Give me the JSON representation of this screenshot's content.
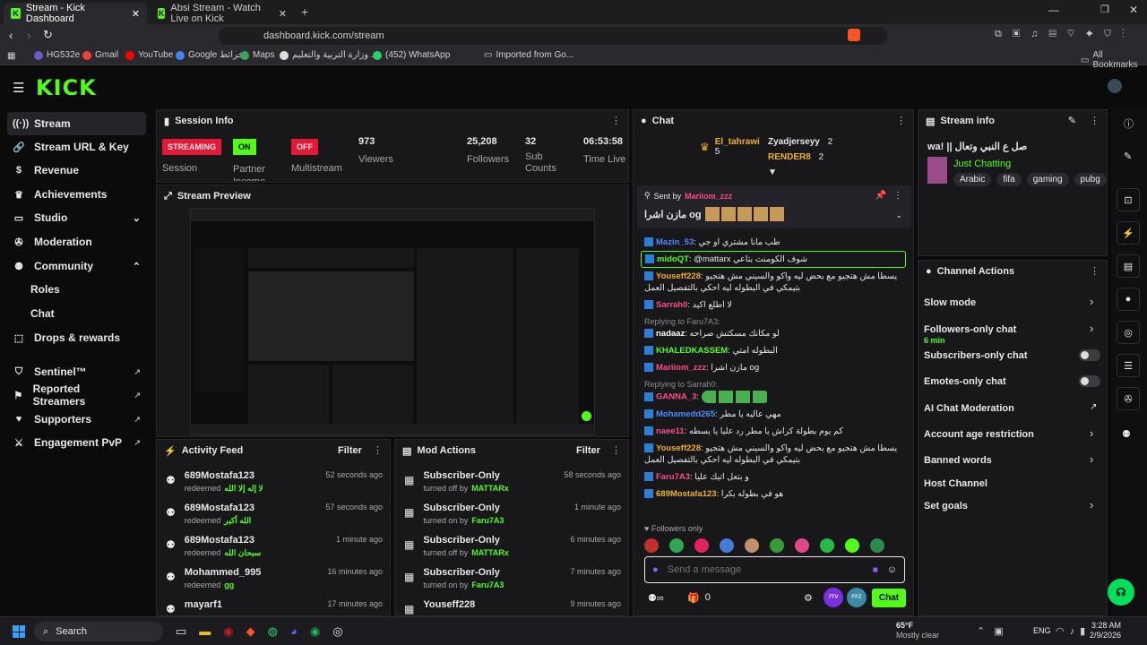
{
  "browser": {
    "tabs": [
      {
        "title": "Stream - Kick Dashboard"
      },
      {
        "title": "Absi Stream - Watch Live on Kick"
      }
    ],
    "url": "dashboard.kick.com/stream",
    "bookmarks": [
      "HG532e",
      "Gmail",
      "YouTube",
      "Google خرائط",
      "Maps",
      "وزارة التربية والتعليم ...",
      "(452) WhatsApp",
      "Imported from Go..."
    ],
    "all_bookmarks": "All Bookmarks"
  },
  "app": {
    "logo": "KICK"
  },
  "sidebar": {
    "items": [
      {
        "label": "Stream",
        "icon": "broadcast-icon"
      },
      {
        "label": "Stream URL & Key",
        "icon": "link-icon"
      },
      {
        "label": "Revenue",
        "icon": "dollar-icon"
      },
      {
        "label": "Achievements",
        "icon": "trophy-icon"
      },
      {
        "label": "Studio",
        "icon": "monitor-icon"
      },
      {
        "label": "Moderation",
        "icon": "wrench-icon"
      },
      {
        "label": "Community",
        "icon": "people-icon"
      },
      {
        "label": "Roles",
        "icon": ""
      },
      {
        "label": "Chat",
        "icon": ""
      },
      {
        "label": "Drops & rewards",
        "icon": "gift-icon"
      },
      {
        "label": "Sentinel™",
        "icon": "shield-icon"
      },
      {
        "label": "Reported Streamers",
        "icon": "flag-icon"
      },
      {
        "label": "Supporters",
        "icon": "heart-icon"
      },
      {
        "label": "Engagement PvP",
        "icon": "swords-icon"
      }
    ]
  },
  "session": {
    "title": "Session Info",
    "streaming_badge": "STREAMING",
    "partner_badge": "ON",
    "multistream_badge": "OFF",
    "session_label": "Session",
    "partner_label": "Partner Income",
    "multistream_label": "Multistream",
    "viewers_value": "973",
    "viewers_label": "Viewers",
    "followers_value": "25,208",
    "followers_label": "Followers",
    "subs_value": "32",
    "subs_label": "Sub Counts",
    "time_value": "06:53:58",
    "time_label": "Time Live"
  },
  "preview": {
    "title": "Stream Preview"
  },
  "activity": {
    "title": "Activity Feed",
    "filter": "Filter",
    "rows": [
      {
        "name": "689Mostafa123",
        "sub": "redeemed",
        "reward": "لا إله إلا الله",
        "time": "52 seconds ago"
      },
      {
        "name": "689Mostafa123",
        "sub": "redeemed",
        "reward": "الله أكبر",
        "time": "57 seconds ago"
      },
      {
        "name": "689Mostafa123",
        "sub": "redeemed",
        "reward": "سبحان الله",
        "time": "1 minute ago"
      },
      {
        "name": "Mohammed_995",
        "sub": "redeemed",
        "reward": "gg",
        "time": "16 minutes ago"
      },
      {
        "name": "mayarf1",
        "sub": "",
        "reward": "",
        "time": "17 minutes ago"
      }
    ]
  },
  "mod": {
    "title": "Mod Actions",
    "filter": "Filter",
    "rows": [
      {
        "name": "Subscriber-Only",
        "sub": "turned off by",
        "by": "MATTARx",
        "time": "58 seconds ago"
      },
      {
        "name": "Subscriber-Only",
        "sub": "turned on by",
        "by": "Faru7A3",
        "time": "1 minute ago"
      },
      {
        "name": "Subscriber-Only",
        "sub": "turned off by",
        "by": "MATTARx",
        "time": "6 minutes ago"
      },
      {
        "name": "Subscriber-Only",
        "sub": "turned on by",
        "by": "Faru7A3",
        "time": "7 minutes ago"
      },
      {
        "name": "Youseff228",
        "sub": "",
        "by": "",
        "time": "9 minutes ago"
      }
    ]
  },
  "chat": {
    "title": "Chat",
    "top_users": [
      {
        "name": "El_tahrawi",
        "count": "5"
      },
      {
        "name": "Zyadjerseyy",
        "count": "2"
      },
      {
        "name": "RENDER8",
        "count": "2"
      }
    ],
    "pinned": {
      "sent_by": "Sent by",
      "user": "Mariiom_zzz",
      "text": "مازن اشرا og"
    },
    "messages": [
      {
        "user": "Mazin_53",
        "text": "طب مانا مشتري او جي",
        "color": "#4a8cff"
      },
      {
        "user": "midoQT",
        "text": "@mattarx شوف الكومنت بتاعي",
        "color": "#53fc18"
      },
      {
        "user": "Youseff228",
        "text": "يسطا مش هتجيو مع بحض ليه واكو والسيني مش هتجيو بتيمكي في البطوله ليه احكي بالتفصيل العمل",
        "color": "#f0b020"
      },
      {
        "user": "Sarrah0",
        "text": "لا اطلع اكيد",
        "color": "#ff4a8a"
      },
      {
        "user": "nadaaz",
        "text": "لو مكانك مسكتش صراحه",
        "color": "#ffffff",
        "reply": "Replying to Faru7A3:"
      },
      {
        "user": "KHALEDKASSEM",
        "text": "البطوله امتي",
        "color": "#53fc18"
      },
      {
        "user": "Mariiom_zzz",
        "text": "مازن اشرا og",
        "color": "#ff4a8a"
      },
      {
        "user": "GANNA_3",
        "text": "",
        "color": "#ff4a8a",
        "reply": "Replying to Sarrah0:"
      },
      {
        "user": "Mohamedd265",
        "text": "مهي عاليه يا مطر",
        "color": "#4a8cff"
      },
      {
        "user": "naee11",
        "text": "كم يوم بطولة كراش يا مطر رد عليا يا بسطه",
        "color": "#ff4a8a"
      },
      {
        "user": "Youseff228",
        "text": "يسطا مش هتجيو مع بحض ليه واكو والسيني مش هتجيو بتيمكي في البطوله ليه احكي بالتفصيل العمل",
        "color": "#f0b020"
      },
      {
        "user": "Faru7A3",
        "text": "و بتعل اتيك عليا",
        "color": "#ff4a8a"
      },
      {
        "user": "689Mostafa123",
        "text": "هو في بطوله بكرا",
        "color": "#f0b020"
      }
    ],
    "followers_only": "Followers only",
    "input_placeholder": "Send a message",
    "count": "0",
    "send_label": "Chat",
    "badge_7tv": "7TV",
    "badge_ffz": "FFZ"
  },
  "stream_info": {
    "title": "Stream info",
    "stream_title": "wa! || صل ع النبي وتعال",
    "category": "Just Chatting",
    "tags": [
      "Arabic",
      "fifa",
      "gaming",
      "pubg"
    ]
  },
  "channel_actions": {
    "title": "Channel Actions",
    "items": [
      {
        "label": "Slow mode",
        "sub": "",
        "kind": "chevron"
      },
      {
        "label": "Followers-only chat",
        "sub": "6 min",
        "kind": "chevron"
      },
      {
        "label": "Subscribers-only chat",
        "sub": "",
        "kind": "toggle"
      },
      {
        "label": "Emotes-only chat",
        "sub": "",
        "kind": "toggle"
      },
      {
        "label": "AI Chat Moderation",
        "sub": "",
        "kind": "external"
      },
      {
        "label": "Account age restriction",
        "sub": "",
        "kind": "chevron"
      },
      {
        "label": "Banned words",
        "sub": "",
        "kind": "chevron"
      },
      {
        "label": "Host Channel",
        "sub": "",
        "kind": "none"
      },
      {
        "label": "Set goals",
        "sub": "",
        "kind": "chevron"
      }
    ]
  },
  "taskbar": {
    "search": "Search",
    "weather_temp": "65°F",
    "weather_desc": "Mostly clear",
    "lang": "ENG",
    "time": "3:28 AM",
    "date": "2/9/2026"
  }
}
